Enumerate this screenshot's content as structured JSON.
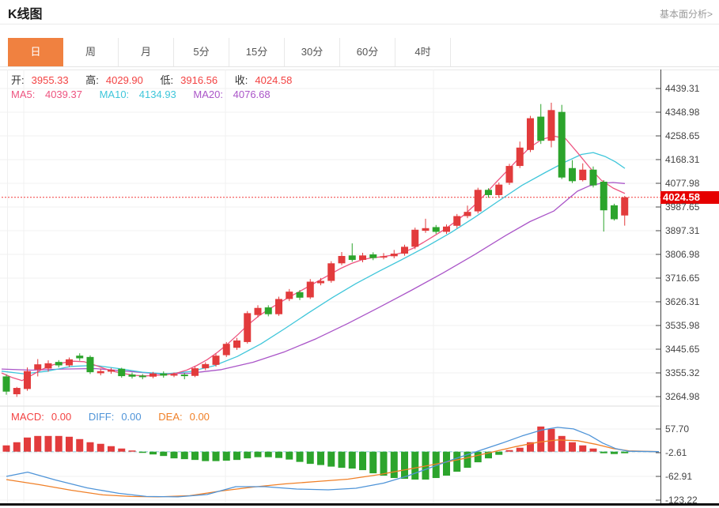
{
  "header": {
    "title": "K线图",
    "link": "基本面分析>"
  },
  "tabs": {
    "items": [
      "日",
      "周",
      "月",
      "5分",
      "15分",
      "30分",
      "60分",
      "4时"
    ],
    "active_index": 0
  },
  "ohlc": {
    "open_label": "开:",
    "open": "3955.33",
    "high_label": "高:",
    "high": "4029.90",
    "low_label": "低:",
    "low": "3916.56",
    "close_label": "收:",
    "close": "4024.58"
  },
  "ma": {
    "ma5_label": "MA5:",
    "ma5": "4039.37",
    "ma10_label": "MA10:",
    "ma10": "4134.93",
    "ma20_label": "MA20:",
    "ma20": "4076.68"
  },
  "macd_header": {
    "macd_label": "MACD:",
    "macd": "0.00",
    "diff_label": "DIFF:",
    "diff": "0.00",
    "dea_label": "DEA:",
    "dea": "0.00"
  },
  "price_tag": "4024.58",
  "colors": {
    "up": "#e23b3c",
    "down": "#2ca42c",
    "ma5": "#ee5480",
    "ma10": "#3fc6da",
    "ma20": "#aa55c8",
    "diff": "#4f94d8",
    "dea": "#f08028",
    "ohlc_value": "#f34242",
    "label_dark": "#333333",
    "tag_bg": "#e60000",
    "price_dash": "#f23b3b",
    "zero_dash": "#8fd0e2",
    "grid": "#f0f0f0",
    "axis": "#444444",
    "tab_active_bg": "#f08140",
    "black_bar": "#111111"
  },
  "chart_data": [
    {
      "type": "candlestick",
      "title": "K线图",
      "panel": "main",
      "legend": [
        "MA5",
        "MA10",
        "MA20"
      ],
      "y_ticks": [
        4439.31,
        4348.98,
        4258.65,
        4168.31,
        4077.98,
        3987.65,
        3897.31,
        3806.98,
        3716.65,
        3626.31,
        3535.98,
        3445.65,
        3355.32,
        3264.98
      ],
      "ylim": [
        3264.98,
        4439.31
      ],
      "grid": true,
      "current_price": 4024.58,
      "last_ohlc": {
        "open": 3955.33,
        "high": 4029.9,
        "low": 3916.56,
        "close": 4024.58
      },
      "ma_last": {
        "ma5": 4039.37,
        "ma10": 4134.93,
        "ma20": 4076.68
      },
      "candles": [
        [
          3342,
          3350,
          3272,
          3284
        ],
        [
          3274,
          3302,
          3264,
          3298
        ],
        [
          3294,
          3376,
          3287,
          3362
        ],
        [
          3368,
          3408,
          3342,
          3388
        ],
        [
          3372,
          3403,
          3360,
          3392
        ],
        [
          3397,
          3404,
          3376,
          3384
        ],
        [
          3384,
          3414,
          3378,
          3407
        ],
        [
          3421,
          3430,
          3402,
          3411
        ],
        [
          3416,
          3422,
          3351,
          3358
        ],
        [
          3354,
          3372,
          3346,
          3362
        ],
        [
          3360,
          3374,
          3352,
          3367
        ],
        [
          3371,
          3375,
          3337,
          3343
        ],
        [
          3349,
          3357,
          3334,
          3341
        ],
        [
          3345,
          3351,
          3331,
          3339
        ],
        [
          3341,
          3359,
          3335,
          3353
        ],
        [
          3353,
          3361,
          3337,
          3345
        ],
        [
          3345,
          3357,
          3339,
          3351
        ],
        [
          3349,
          3355,
          3331,
          3343
        ],
        [
          3344,
          3379,
          3339,
          3373
        ],
        [
          3373,
          3396,
          3366,
          3389
        ],
        [
          3386,
          3429,
          3379,
          3421
        ],
        [
          3423,
          3473,
          3416,
          3466
        ],
        [
          3451,
          3489,
          3443,
          3479
        ],
        [
          3473,
          3591,
          3467,
          3583
        ],
        [
          3576,
          3613,
          3567,
          3603
        ],
        [
          3605,
          3613,
          3571,
          3579
        ],
        [
          3579,
          3646,
          3573,
          3637
        ],
        [
          3637,
          3675,
          3629,
          3665
        ],
        [
          3663,
          3671,
          3633,
          3642
        ],
        [
          3643,
          3713,
          3637,
          3703
        ],
        [
          3697,
          3717,
          3689,
          3706
        ],
        [
          3706,
          3781,
          3699,
          3773
        ],
        [
          3773,
          3816,
          3766,
          3801
        ],
        [
          3803,
          3849,
          3779,
          3786
        ],
        [
          3786,
          3813,
          3777,
          3803
        ],
        [
          3807,
          3815,
          3785,
          3793
        ],
        [
          3795,
          3812,
          3788,
          3800
        ],
        [
          3800,
          3824,
          3792,
          3810
        ],
        [
          3810,
          3844,
          3802,
          3836
        ],
        [
          3836,
          3909,
          3827,
          3901
        ],
        [
          3897,
          3943,
          3889,
          3907
        ],
        [
          3911,
          3919,
          3885,
          3893
        ],
        [
          3893,
          3921,
          3885,
          3913
        ],
        [
          3916,
          3961,
          3907,
          3953
        ],
        [
          3953,
          3993,
          3945,
          3969
        ],
        [
          3971,
          4061,
          3963,
          4053
        ],
        [
          4053,
          4059,
          4023,
          4033
        ],
        [
          4033,
          4081,
          4025,
          4073
        ],
        [
          4080,
          4152,
          4072,
          4144
        ],
        [
          4144,
          4237,
          4136,
          4214
        ],
        [
          4205,
          4335,
          4197,
          4326
        ],
        [
          4332,
          4380,
          4228,
          4240
        ],
        [
          4240,
          4385,
          4215,
          4357
        ],
        [
          4350,
          4377,
          4094,
          4100
        ],
        [
          4136,
          4166,
          4079,
          4086
        ],
        [
          4090,
          4154,
          4085,
          4130
        ],
        [
          4130,
          4142,
          4062,
          4070
        ],
        [
          4084,
          4090,
          3894,
          3975
        ],
        [
          3994,
          4000,
          3936,
          3941
        ],
        [
          3955.33,
          4029.9,
          3916.56,
          4024.58
        ]
      ],
      "ma5": [
        [
          2,
          3355
        ],
        [
          15,
          3338
        ],
        [
          28,
          3326
        ],
        [
          41,
          3348
        ],
        [
          54,
          3370
        ],
        [
          67,
          3386
        ],
        [
          80,
          3394
        ],
        [
          93,
          3400
        ],
        [
          106,
          3398
        ],
        [
          119,
          3386
        ],
        [
          132,
          3372
        ],
        [
          145,
          3360
        ],
        [
          158,
          3352
        ],
        [
          171,
          3346
        ],
        [
          184,
          3344
        ],
        [
          197,
          3346
        ],
        [
          210,
          3348
        ],
        [
          223,
          3354
        ],
        [
          236,
          3366
        ],
        [
          249,
          3384
        ],
        [
          262,
          3406
        ],
        [
          275,
          3434
        ],
        [
          288,
          3466
        ],
        [
          301,
          3502
        ],
        [
          314,
          3540
        ],
        [
          327,
          3572
        ],
        [
          340,
          3598
        ],
        [
          353,
          3622
        ],
        [
          366,
          3645
        ],
        [
          379,
          3666
        ],
        [
          392,
          3688
        ],
        [
          405,
          3710
        ],
        [
          418,
          3732
        ],
        [
          431,
          3754
        ],
        [
          444,
          3772
        ],
        [
          457,
          3786
        ],
        [
          470,
          3794
        ],
        [
          483,
          3798
        ],
        [
          496,
          3804
        ],
        [
          509,
          3814
        ],
        [
          522,
          3830
        ],
        [
          535,
          3852
        ],
        [
          548,
          3876
        ],
        [
          561,
          3900
        ],
        [
          574,
          3928
        ],
        [
          587,
          3958
        ],
        [
          600,
          3995
        ],
        [
          613,
          4035
        ],
        [
          626,
          4078
        ],
        [
          640,
          4122
        ],
        [
          655,
          4170
        ],
        [
          670,
          4215
        ],
        [
          685,
          4245
        ],
        [
          700,
          4258
        ],
        [
          715,
          4248
        ],
        [
          730,
          4195
        ],
        [
          745,
          4140
        ],
        [
          760,
          4090
        ],
        [
          775,
          4060
        ],
        [
          790,
          4039
        ]
      ],
      "ma10": [
        [
          2,
          3362
        ],
        [
          30,
          3352
        ],
        [
          60,
          3362
        ],
        [
          90,
          3380
        ],
        [
          120,
          3384
        ],
        [
          150,
          3372
        ],
        [
          180,
          3358
        ],
        [
          210,
          3352
        ],
        [
          240,
          3360
        ],
        [
          270,
          3382
        ],
        [
          300,
          3418
        ],
        [
          330,
          3466
        ],
        [
          360,
          3524
        ],
        [
          390,
          3584
        ],
        [
          420,
          3642
        ],
        [
          450,
          3696
        ],
        [
          480,
          3744
        ],
        [
          510,
          3790
        ],
        [
          540,
          3838
        ],
        [
          570,
          3890
        ],
        [
          600,
          3948
        ],
        [
          630,
          4010
        ],
        [
          660,
          4070
        ],
        [
          690,
          4120
        ],
        [
          715,
          4160
        ],
        [
          735,
          4188
        ],
        [
          750,
          4195
        ],
        [
          765,
          4180
        ],
        [
          778,
          4160
        ],
        [
          790,
          4135
        ]
      ],
      "ma20": [
        [
          2,
          3370
        ],
        [
          40,
          3366
        ],
        [
          80,
          3370
        ],
        [
          120,
          3372
        ],
        [
          160,
          3362
        ],
        [
          200,
          3352
        ],
        [
          240,
          3354
        ],
        [
          280,
          3368
        ],
        [
          320,
          3396
        ],
        [
          360,
          3436
        ],
        [
          400,
          3486
        ],
        [
          440,
          3544
        ],
        [
          480,
          3606
        ],
        [
          520,
          3670
        ],
        [
          560,
          3736
        ],
        [
          600,
          3806
        ],
        [
          640,
          3880
        ],
        [
          670,
          3932
        ],
        [
          700,
          3972
        ],
        [
          715,
          4010
        ],
        [
          730,
          4048
        ],
        [
          745,
          4068
        ],
        [
          760,
          4078
        ],
        [
          775,
          4081
        ],
        [
          790,
          4077
        ]
      ]
    },
    {
      "type": "bar",
      "panel": "macd",
      "legend": [
        "MACD",
        "DIFF",
        "DEA"
      ],
      "y_ticks": [
        57.7,
        -2.61,
        -62.91,
        -123.22
      ],
      "ylim": [
        -123.22,
        57.7
      ],
      "grid": true,
      "histogram": [
        16,
        24,
        36,
        40,
        40,
        40,
        38,
        32,
        24,
        20,
        14,
        8,
        3,
        -3,
        -7,
        -11,
        -17,
        -19,
        -21,
        -24,
        -24,
        -23,
        -21,
        -17,
        -14,
        -14,
        -16,
        -20,
        -26,
        -31,
        -34,
        -38,
        -41,
        -43,
        -47,
        -55,
        -61,
        -67,
        -69,
        -71,
        -71,
        -67,
        -61,
        -51,
        -41,
        -27,
        -17,
        -8,
        4,
        10,
        24,
        64,
        58,
        40,
        24,
        16,
        8,
        -4,
        -6,
        -4
      ],
      "diff_line": [
        [
          8,
          -63
        ],
        [
          35,
          -52
        ],
        [
          70,
          -72
        ],
        [
          110,
          -92
        ],
        [
          150,
          -106
        ],
        [
          185,
          -114
        ],
        [
          225,
          -115
        ],
        [
          262,
          -109
        ],
        [
          298,
          -89
        ],
        [
          335,
          -89
        ],
        [
          375,
          -95
        ],
        [
          415,
          -97
        ],
        [
          450,
          -93
        ],
        [
          485,
          -80
        ],
        [
          515,
          -62
        ],
        [
          545,
          -40
        ],
        [
          575,
          -18
        ],
        [
          605,
          2
        ],
        [
          635,
          22
        ],
        [
          660,
          40
        ],
        [
          685,
          55
        ],
        [
          705,
          62
        ],
        [
          725,
          58
        ],
        [
          745,
          42
        ],
        [
          762,
          22
        ],
        [
          778,
          8
        ],
        [
          795,
          1
        ],
        [
          833,
          0
        ]
      ],
      "dea_line": [
        [
          8,
          -71
        ],
        [
          50,
          -84
        ],
        [
          90,
          -98
        ],
        [
          130,
          -110
        ],
        [
          165,
          -114
        ],
        [
          200,
          -115
        ],
        [
          240,
          -112
        ],
        [
          280,
          -100
        ],
        [
          320,
          -90
        ],
        [
          360,
          -82
        ],
        [
          400,
          -76
        ],
        [
          440,
          -70
        ],
        [
          480,
          -58
        ],
        [
          515,
          -45
        ],
        [
          550,
          -32
        ],
        [
          585,
          -18
        ],
        [
          620,
          -2
        ],
        [
          650,
          12
        ],
        [
          680,
          24
        ],
        [
          705,
          30
        ],
        [
          730,
          28
        ],
        [
          755,
          18
        ],
        [
          775,
          8
        ],
        [
          795,
          2
        ],
        [
          833,
          0
        ]
      ]
    }
  ]
}
